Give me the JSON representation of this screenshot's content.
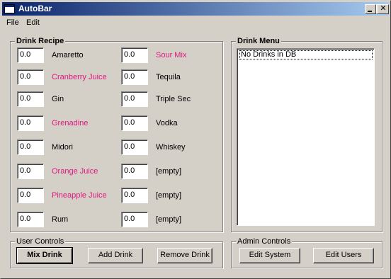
{
  "window": {
    "title": "AutoBar"
  },
  "menu": {
    "file_label": "File",
    "edit_label": "Edit"
  },
  "recipe": {
    "title": "Drink Recipe",
    "left": [
      {
        "value": "0.0",
        "name": "Amaretto",
        "highlight": false
      },
      {
        "value": "0.0",
        "name": "Cranberry Juice",
        "highlight": true
      },
      {
        "value": "0.0",
        "name": "Gin",
        "highlight": false
      },
      {
        "value": "0.0",
        "name": "Grenadine",
        "highlight": true
      },
      {
        "value": "0.0",
        "name": "Midori",
        "highlight": false
      },
      {
        "value": "0.0",
        "name": "Orange Juice",
        "highlight": true
      },
      {
        "value": "0.0",
        "name": "Pineapple Juice",
        "highlight": true
      },
      {
        "value": "0.0",
        "name": "Rum",
        "highlight": false
      }
    ],
    "right": [
      {
        "value": "0.0",
        "name": "Sour Mix",
        "highlight": true
      },
      {
        "value": "0.0",
        "name": "Tequila",
        "highlight": false
      },
      {
        "value": "0.0",
        "name": "Triple Sec",
        "highlight": false
      },
      {
        "value": "0.0",
        "name": "Vodka",
        "highlight": false
      },
      {
        "value": "0.0",
        "name": "Whiskey",
        "highlight": false
      },
      {
        "value": "0.0",
        "name": "[empty]",
        "highlight": false
      },
      {
        "value": "0.0",
        "name": "[empty]",
        "highlight": false
      },
      {
        "value": "0.0",
        "name": "[empty]",
        "highlight": false
      }
    ]
  },
  "drink_menu": {
    "title": "Drink Menu",
    "items": [
      "No Drinks in DB"
    ]
  },
  "user_controls": {
    "title": "User Controls",
    "mix_label": "Mix Drink",
    "add_label": "Add Drink",
    "remove_label": "Remove Drink"
  },
  "admin_controls": {
    "title": "Admin Controls",
    "system_label": "Edit System",
    "users_label": "Edit Users"
  },
  "colors": {
    "highlight": "#e0157e",
    "titlebar": "#0a246a",
    "face": "#d4d0c8"
  }
}
